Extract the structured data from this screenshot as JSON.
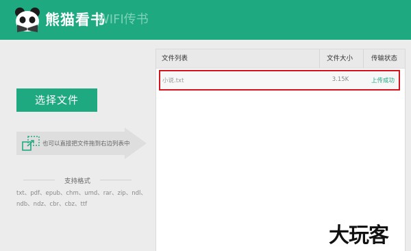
{
  "header": {
    "brand": "熊猫看书",
    "subtitle": "WIFI传书",
    "bg_color": "#1fa980",
    "logo_icon": "panda-icon"
  },
  "left": {
    "select_button": "选择文件",
    "drag_tip": "也可以直接把文件拖到右边列表中",
    "formats_title": "支持格式",
    "formats_text": "txt、pdf、epub、chm、umd、rar、zip、ndl、ndb、ndz、cbr、cbz、ttf"
  },
  "file_table": {
    "columns": [
      "文件列表",
      "文件大小",
      "传输状态"
    ],
    "rows": [
      {
        "name": "小说.txt",
        "size": "3.15K",
        "status": "上传成功"
      }
    ]
  },
  "watermark": "大玩客",
  "colors": {
    "accent": "#1fa980",
    "highlight_border": "#d4141d"
  }
}
